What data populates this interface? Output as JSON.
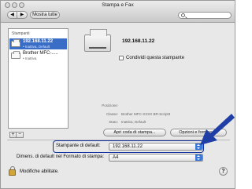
{
  "window": {
    "title": "Stampa e Fax"
  },
  "toolbar": {
    "back_symbol": "◀",
    "forward_symbol": "▶",
    "show_all_label": "Mostra tutte",
    "search_placeholder": ""
  },
  "printer_list": {
    "header": "Stampanti",
    "items": [
      {
        "name": "192.168.11.22",
        "status": "• Inattiva, Default",
        "selected": true
      },
      {
        "name": "Brother MFC-.....",
        "status": "• Inattiva",
        "selected": false
      }
    ],
    "add_symbol": "+",
    "remove_symbol": "−"
  },
  "detail": {
    "printer_name": "192.168.11.22",
    "share_label": "Condividi questa stampante",
    "share_checked": false,
    "rows": [
      {
        "label": "Posizione:",
        "value": ""
      },
      {
        "label": "Classe:",
        "value": "Brother MFC-XXXX BR-Script3"
      },
      {
        "label": "Stato:",
        "value": "Inattiva, Default"
      }
    ],
    "queue_button": "Apri coda di stampa...",
    "options_button": "Opzioni e forniture..."
  },
  "defaults": {
    "default_printer_label": "Stampante di default:",
    "default_printer_value": "192.168.11.22",
    "paper_size_label": "Dimens. di default nel Formato di stampa:",
    "paper_size_value": "A4"
  },
  "footer": {
    "lock_label": "Modifiche abilitate.",
    "help_symbol": "?"
  },
  "colors": {
    "selection": "#3a6ec6",
    "callout": "#1f3fa6",
    "popup_accent": "#3c78d8"
  }
}
